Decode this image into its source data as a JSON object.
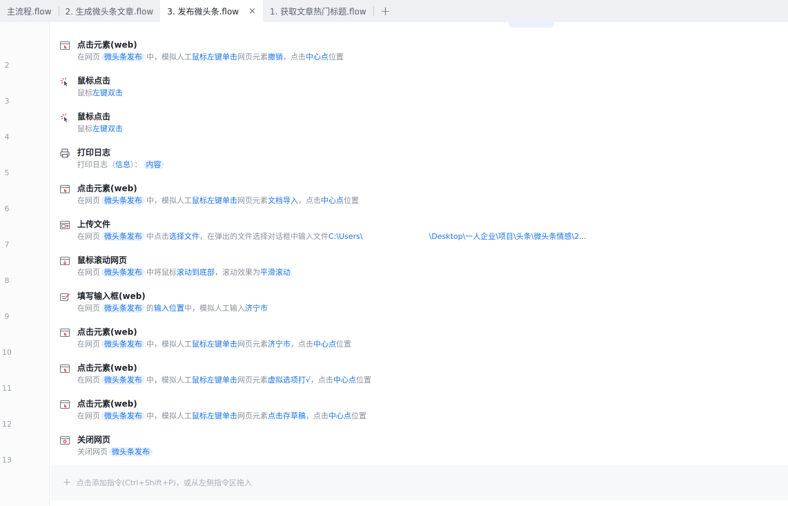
{
  "tabs": [
    {
      "label": "主流程.flow",
      "active": false
    },
    {
      "label": "2. 生成微头条文章.flow",
      "active": false
    },
    {
      "label": "3. 发布微头条.flow",
      "active": true
    },
    {
      "label": "1. 获取文章热门标题.flow",
      "active": false
    }
  ],
  "tab_close_glyph": "×",
  "tab_add_glyph": "+",
  "line_numbers": [
    "2",
    "3",
    "4",
    "5",
    "6",
    "7",
    "8",
    "9",
    "10",
    "11",
    "12",
    "13"
  ],
  "steps": [
    {
      "icon": "web-click-icon",
      "title": "点击元素(web)",
      "desc": [
        [
          "t",
          "在网页"
        ],
        [
          "p",
          "微头条发布"
        ],
        [
          "t",
          "中，模拟人工"
        ],
        [
          "h",
          "鼠标左键单击"
        ],
        [
          "t",
          "网页元素"
        ],
        [
          "h",
          "撤销"
        ],
        [
          "t",
          "，点击"
        ],
        [
          "h",
          "中心点"
        ],
        [
          "t",
          "位置"
        ]
      ]
    },
    {
      "icon": "mouse-click-icon",
      "title": "鼠标点击",
      "desc": [
        [
          "t",
          "鼠标"
        ],
        [
          "h",
          "左键双击"
        ]
      ]
    },
    {
      "icon": "mouse-click-icon",
      "title": "鼠标点击",
      "desc": [
        [
          "t",
          "鼠标"
        ],
        [
          "h",
          "左键双击"
        ]
      ]
    },
    {
      "icon": "print-log-icon",
      "title": "打印日志",
      "desc": [
        [
          "t",
          "打印日志（"
        ],
        [
          "h",
          "信息"
        ],
        [
          "t",
          "）："
        ],
        [
          "p",
          "内容"
        ]
      ]
    },
    {
      "icon": "web-click-icon",
      "title": "点击元素(web)",
      "desc": [
        [
          "t",
          "在网页"
        ],
        [
          "p",
          "微头条发布"
        ],
        [
          "t",
          "中，模拟人工"
        ],
        [
          "h",
          "鼠标左键单击"
        ],
        [
          "t",
          "网页元素"
        ],
        [
          "h",
          "文档导入"
        ],
        [
          "t",
          "，点击"
        ],
        [
          "h",
          "中心点"
        ],
        [
          "t",
          "位置"
        ]
      ]
    },
    {
      "icon": "upload-file-icon",
      "title": "上传文件",
      "desc": [
        [
          "t",
          "在网页"
        ],
        [
          "p",
          "微头条发布"
        ],
        [
          "t",
          "中点击"
        ],
        [
          "h",
          "选择文件"
        ],
        [
          "t",
          "，在弹出的文件选择对话框中输入文件"
        ],
        [
          "h",
          "C:\\Users\\"
        ],
        [
          "m",
          ""
        ],
        [
          "h",
          "\\Desktop\\一人企业\\项目\\头条\\微头条情感\\2..."
        ]
      ]
    },
    {
      "icon": "scroll-page-icon",
      "title": "鼠标滚动网页",
      "desc": [
        [
          "t",
          "在网页"
        ],
        [
          "p",
          "微头条发布"
        ],
        [
          "t",
          "中将鼠标"
        ],
        [
          "h",
          "滚动到底部"
        ],
        [
          "t",
          "，滚动效果为"
        ],
        [
          "h",
          "平滑滚动"
        ]
      ]
    },
    {
      "icon": "fill-input-icon",
      "title": "填写输入框(web)",
      "desc": [
        [
          "t",
          "在网页"
        ],
        [
          "p",
          "微头条发布"
        ],
        [
          "t",
          "的"
        ],
        [
          "h",
          "输入位置"
        ],
        [
          "t",
          "中，模拟人工输入"
        ],
        [
          "h",
          "济宁市"
        ]
      ]
    },
    {
      "icon": "web-click-icon",
      "title": "点击元素(web)",
      "desc": [
        [
          "t",
          "在网页"
        ],
        [
          "p",
          "微头条发布"
        ],
        [
          "t",
          "中，模拟人工"
        ],
        [
          "h",
          "鼠标左键单击"
        ],
        [
          "t",
          "网页元素"
        ],
        [
          "h",
          "济宁市"
        ],
        [
          "t",
          "，点击"
        ],
        [
          "h",
          "中心点"
        ],
        [
          "t",
          "位置"
        ]
      ]
    },
    {
      "icon": "web-click-icon",
      "title": "点击元素(web)",
      "desc": [
        [
          "t",
          "在网页"
        ],
        [
          "p",
          "微头条发布"
        ],
        [
          "t",
          "中，模拟人工"
        ],
        [
          "h",
          "鼠标左键单击"
        ],
        [
          "t",
          "网页元素"
        ],
        [
          "h",
          "虚拟选项打√"
        ],
        [
          "t",
          "，点击"
        ],
        [
          "h",
          "中心点"
        ],
        [
          "t",
          "位置"
        ]
      ]
    },
    {
      "icon": "web-click-icon",
      "title": "点击元素(web)",
      "desc": [
        [
          "t",
          "在网页"
        ],
        [
          "p",
          "微头条发布"
        ],
        [
          "t",
          "中，模拟人工"
        ],
        [
          "h",
          "鼠标左键单击"
        ],
        [
          "t",
          "网页元素"
        ],
        [
          "h",
          "点击存草稿"
        ],
        [
          "t",
          "，点击"
        ],
        [
          "h",
          "中心点"
        ],
        [
          "t",
          "位置"
        ]
      ]
    },
    {
      "icon": "close-page-icon",
      "title": "关闭网页",
      "desc": [
        [
          "t",
          "关闭网页"
        ],
        [
          "p",
          "微头条发布"
        ]
      ]
    }
  ],
  "add_bar": {
    "glyph": "+",
    "text": "点击添加指令(Ctrl+Shift+P)，或从左侧指令区拖入"
  },
  "colors": {
    "accent": "#1a73e8",
    "pill_bg": "#e8f1fd",
    "tabbar_bg": "#eef0f4",
    "title": "#1f2329",
    "muted": "#8a909a"
  }
}
